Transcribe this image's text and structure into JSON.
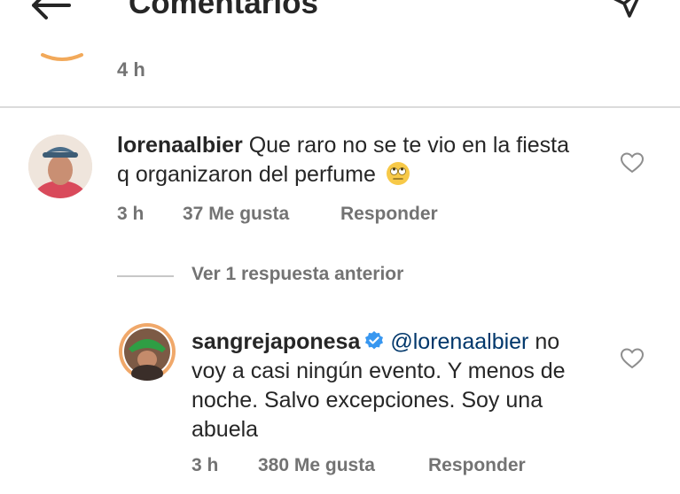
{
  "header": {
    "title": "Comentarios"
  },
  "previous_comment": {
    "time": "4 h"
  },
  "comments": [
    {
      "username": "lorenaalbier",
      "text": "Que raro no se te vio en la fiesta q organizaron del perfume",
      "emoji": "face-with-rolling-eyes",
      "time": "3 h",
      "likes": "37 Me gusta",
      "reply_label": "Responder"
    },
    {
      "username": "sangrejaponesa",
      "verified": true,
      "mention": "@lorenaalbier",
      "text": "no voy a casi ningún evento. Y menos de noche. Salvo excepciones. Soy una abuela",
      "time": "3 h",
      "likes": "380 Me gusta",
      "reply_label": "Responder"
    }
  ],
  "view_replies": "Ver 1 respuesta anterior",
  "icons": {
    "back": "arrow-left-icon",
    "send": "paper-plane-icon",
    "like": "heart-icon",
    "verified": "verified-badge-icon"
  },
  "colors": {
    "text": "#262626",
    "secondary": "#737373",
    "mention": "#00376b",
    "verified": "#3897f0",
    "divider": "#dbdbdb"
  }
}
